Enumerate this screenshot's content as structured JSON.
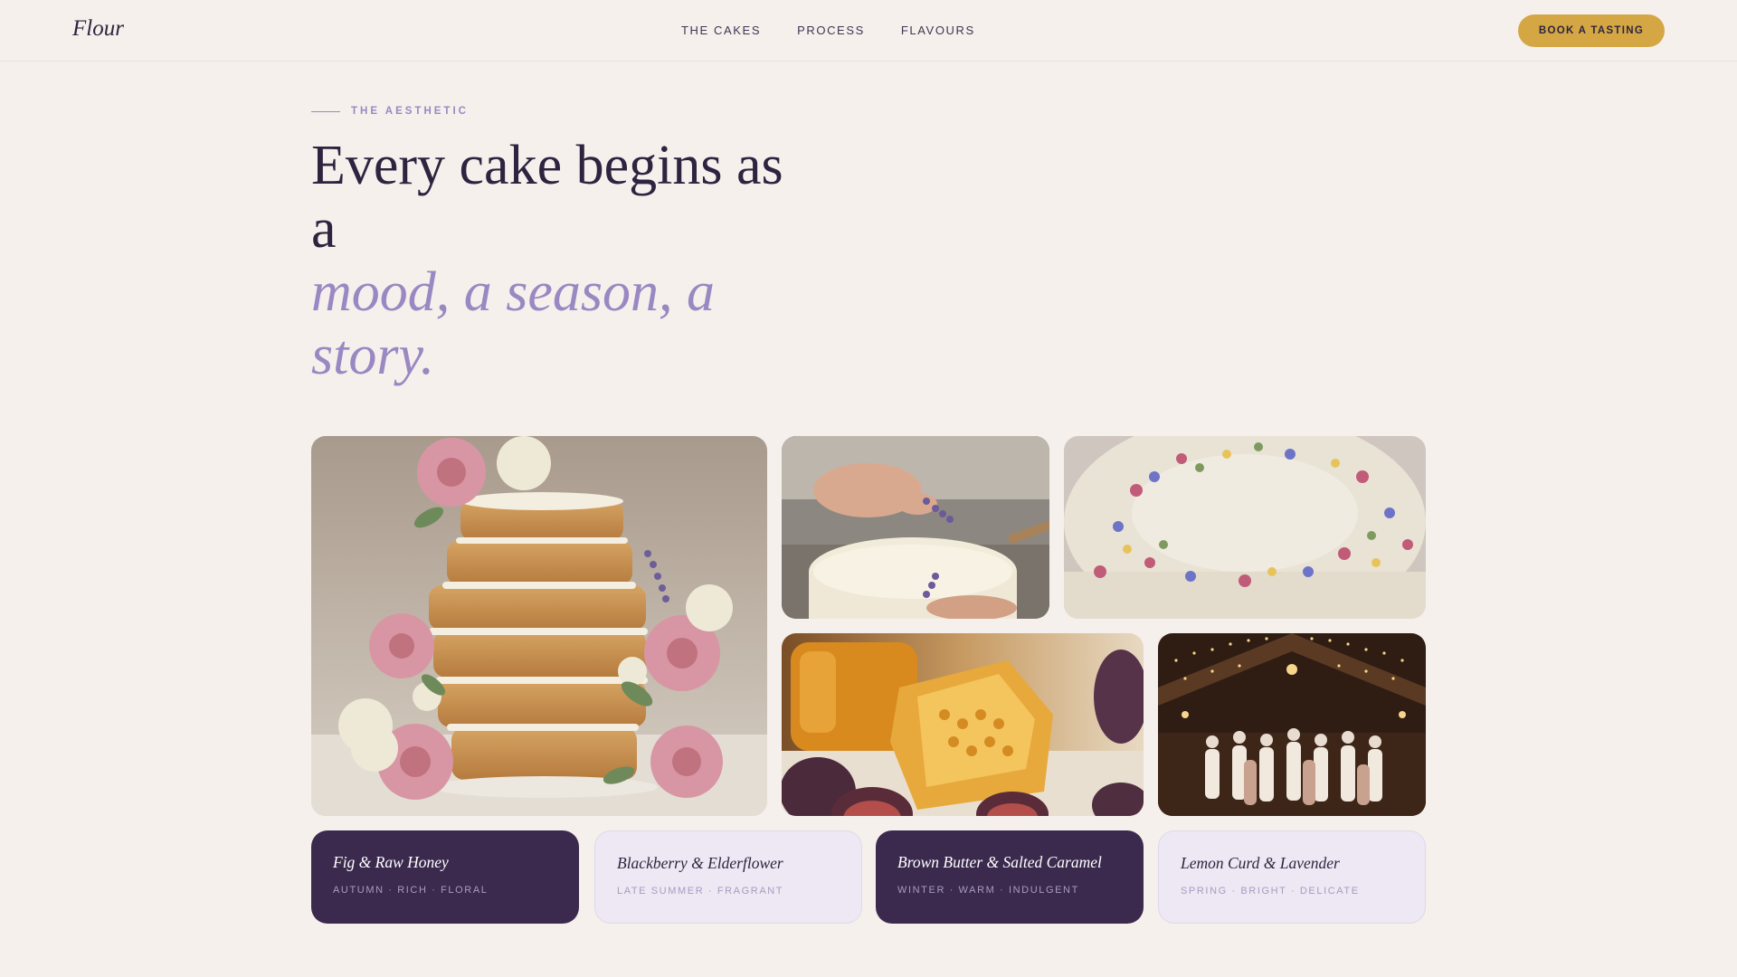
{
  "brand": {
    "logo": "Flour"
  },
  "nav": {
    "links": [
      "THE CAKES",
      "PROCESS",
      "FLAVOURS"
    ],
    "cta": "BOOK A TASTING"
  },
  "hero": {
    "eyebrow": "THE AESTHETIC",
    "headline_line1": "Every cake begins as a",
    "headline_accent": "mood, a season, a story."
  },
  "gallery": {
    "images": [
      {
        "subject": "naked-layer-cake-with-roses"
      },
      {
        "subject": "hands-placing-lavender-on-cake"
      },
      {
        "subject": "cake-with-pressed-petals"
      },
      {
        "subject": "honeycomb-and-figs"
      },
      {
        "subject": "barn-wedding-party"
      }
    ]
  },
  "flavours": [
    {
      "name": "Fig & Raw Honey",
      "tags": "AUTUMN · RICH · FLORAL",
      "style": "dark"
    },
    {
      "name": "Blackberry & Elderflower",
      "tags": "LATE SUMMER · FRAGRANT",
      "style": "light"
    },
    {
      "name": "Brown Butter & Salted Caramel",
      "tags": "WINTER · WARM · INDULGENT",
      "style": "dark"
    },
    {
      "name": "Lemon Curd & Lavender",
      "tags": "SPRING · BRIGHT · DELICATE",
      "style": "light"
    }
  ],
  "colors": {
    "background": "#f5f0ec",
    "ink": "#2e2440",
    "lavender": "#9a88c2",
    "gold": "#d4a744",
    "plum": "#3b2a4e"
  }
}
